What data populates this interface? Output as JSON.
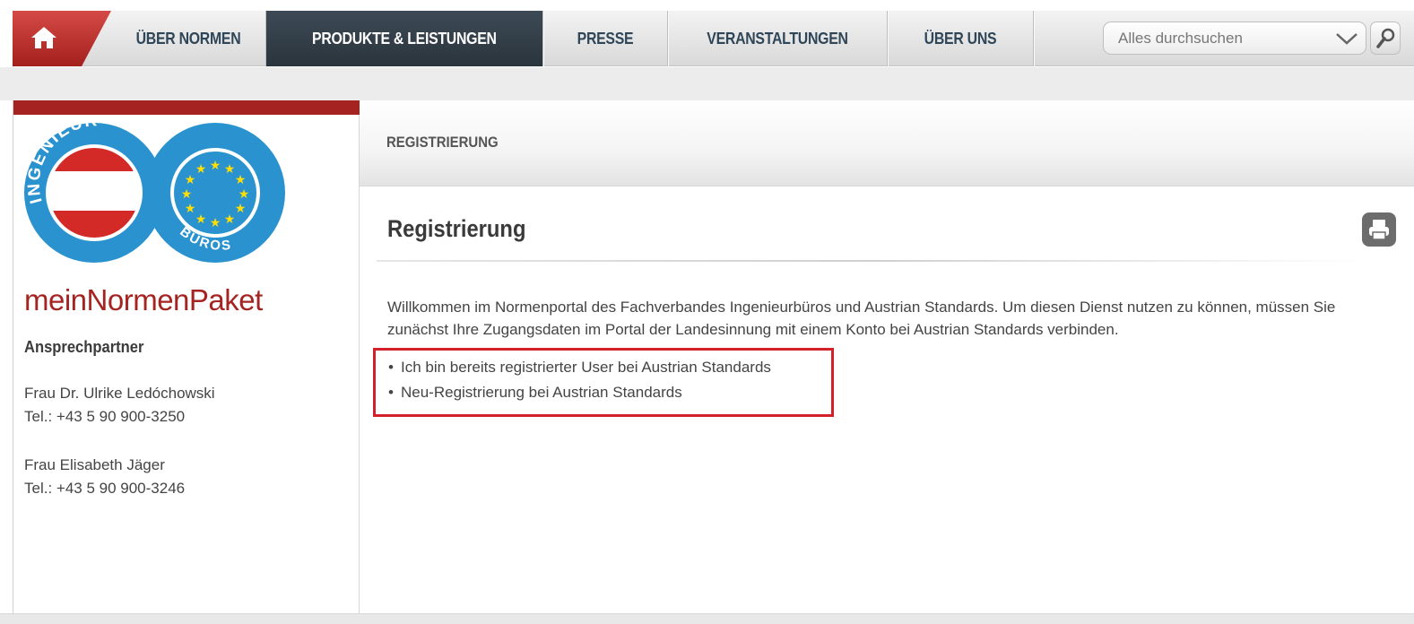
{
  "nav": {
    "items": [
      "ÜBER NORMEN",
      "PRODUKTE & LEISTUNGEN",
      "PRESSE",
      "VERANSTALTUNGEN",
      "ÜBER UNS"
    ],
    "active": "PRODUKTE & LEISTUNGEN",
    "search_placeholder": "Alles durchsuchen",
    "colors": {
      "home": "#a52422",
      "active_bg": "#323d46",
      "text": "#2f4658"
    }
  },
  "sidebar": {
    "logo": {
      "top_text": "INGENIEUR",
      "bottom_text": "BÜROS"
    },
    "brand": "meinNormenPaket",
    "contact_heading": "Ansprechpartner",
    "contacts": [
      {
        "name": "Frau Dr. Ulrike Ledóchowski",
        "phone": "Tel.: +43 5 90 900-3250"
      },
      {
        "name": "Frau Elisabeth Jäger",
        "phone": "Tel.: +43 5 90 900-3246"
      }
    ]
  },
  "main": {
    "breadcrumb": "REGISTRIERUNG",
    "title": "Registrierung",
    "intro": "Willkommen im Normenportal des Fachverbandes Ingenieurbüros und Austrian Standards. Um diesen Dienst nutzen zu können, müssen Sie zunächst Ihre Zugangsdaten im Portal der Landesinnung mit einem Konto bei Austrian Standards verbinden.",
    "options": [
      "Ich bin bereits registrierter User bei Austrian Standards",
      "Neu-Registrierung bei Austrian Standards"
    ],
    "highlight_color": "#d3202b"
  }
}
